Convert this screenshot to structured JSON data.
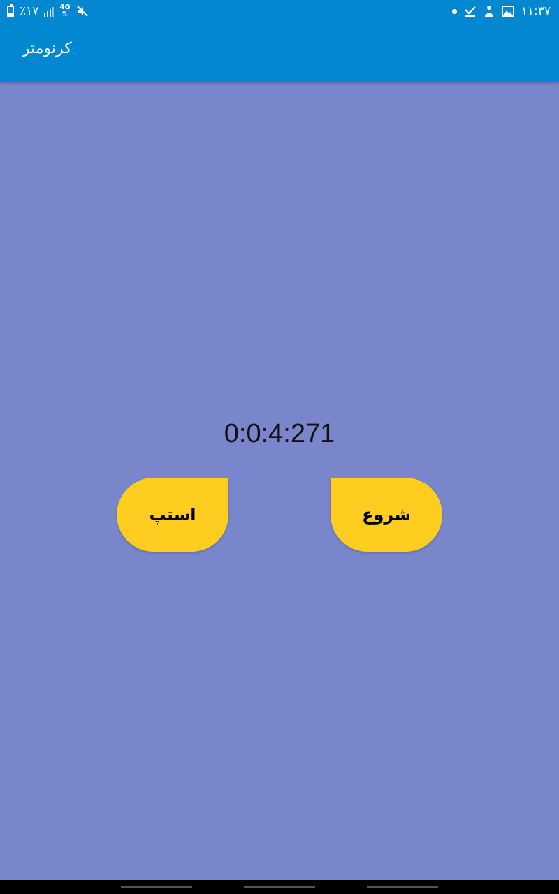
{
  "status_bar": {
    "battery_text": "٪۱۷",
    "network_type": "4G",
    "time": "۱۱:۳۷"
  },
  "app_bar": {
    "title": "کرنومتر"
  },
  "timer": {
    "value": "0:0:4:271"
  },
  "buttons": {
    "stop_label": "استپ",
    "start_label": "شروع"
  },
  "colors": {
    "background": "#7986CB",
    "app_bar": "#0288D1",
    "button": "#FFCD1F"
  },
  "icons": [
    "battery-icon",
    "signal-icon",
    "mute-icon",
    "dot-icon",
    "check-icon",
    "gesture-icon",
    "image-icon"
  ]
}
